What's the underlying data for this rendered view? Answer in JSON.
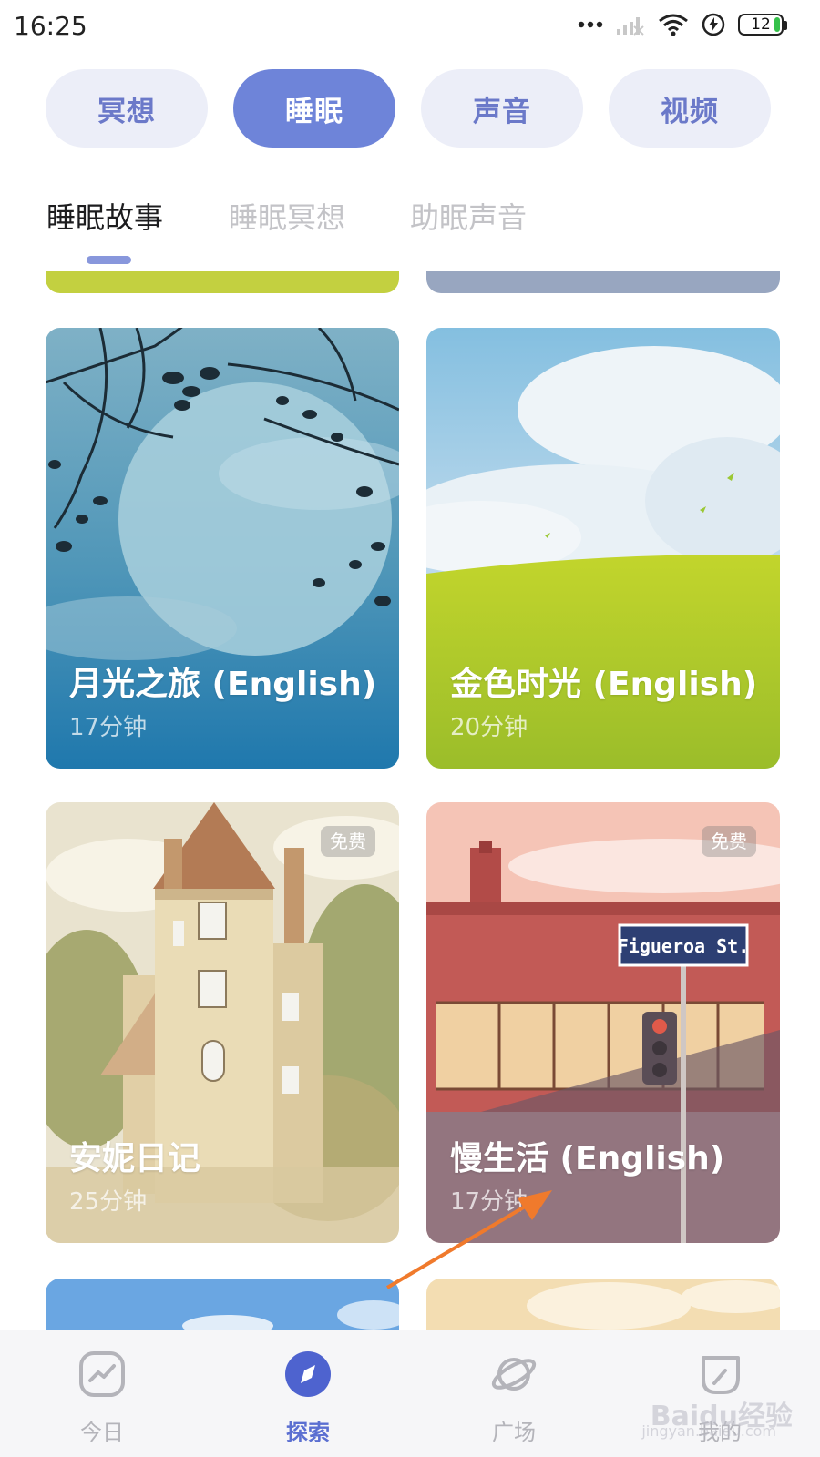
{
  "status_bar": {
    "time": "16:25",
    "battery": "12",
    "icons": [
      "more-dots-icon",
      "signal-icon",
      "wifi-icon",
      "charging-icon",
      "battery-icon"
    ]
  },
  "categories": [
    {
      "label": "冥想",
      "active": false
    },
    {
      "label": "睡眠",
      "active": true
    },
    {
      "label": "声音",
      "active": false
    },
    {
      "label": "视频",
      "active": false
    }
  ],
  "subtabs": [
    {
      "label": "睡眠故事",
      "active": true
    },
    {
      "label": "睡眠冥想",
      "active": false
    },
    {
      "label": "助眠声音",
      "active": false
    }
  ],
  "cards": [
    {
      "title": "月光之旅 (English)",
      "duration": "17分钟",
      "badge": ""
    },
    {
      "title": "金色时光 (English)",
      "duration": "20分钟",
      "badge": ""
    },
    {
      "title": "安妮日记",
      "duration": "25分钟",
      "badge": "免费"
    },
    {
      "title": "慢生活 (English)",
      "duration": "17分钟",
      "badge": "免费",
      "sign_text": "Figueroa St."
    }
  ],
  "bottom_nav": [
    {
      "label": "今日",
      "icon": "trend-icon",
      "active": false
    },
    {
      "label": "探索",
      "icon": "compass-icon",
      "active": true
    },
    {
      "label": "广场",
      "icon": "planet-icon",
      "active": false
    },
    {
      "label": "我的",
      "icon": "leaf-icon",
      "active": false
    }
  ],
  "watermark": {
    "text": "Baidu经验",
    "sub": "jingyan.baidu.com"
  },
  "colors": {
    "accent": "#6e84d9",
    "pill_bg": "#eceef8",
    "pill_text": "#6b79c9",
    "annotation_arrow": "#f07a2c"
  }
}
